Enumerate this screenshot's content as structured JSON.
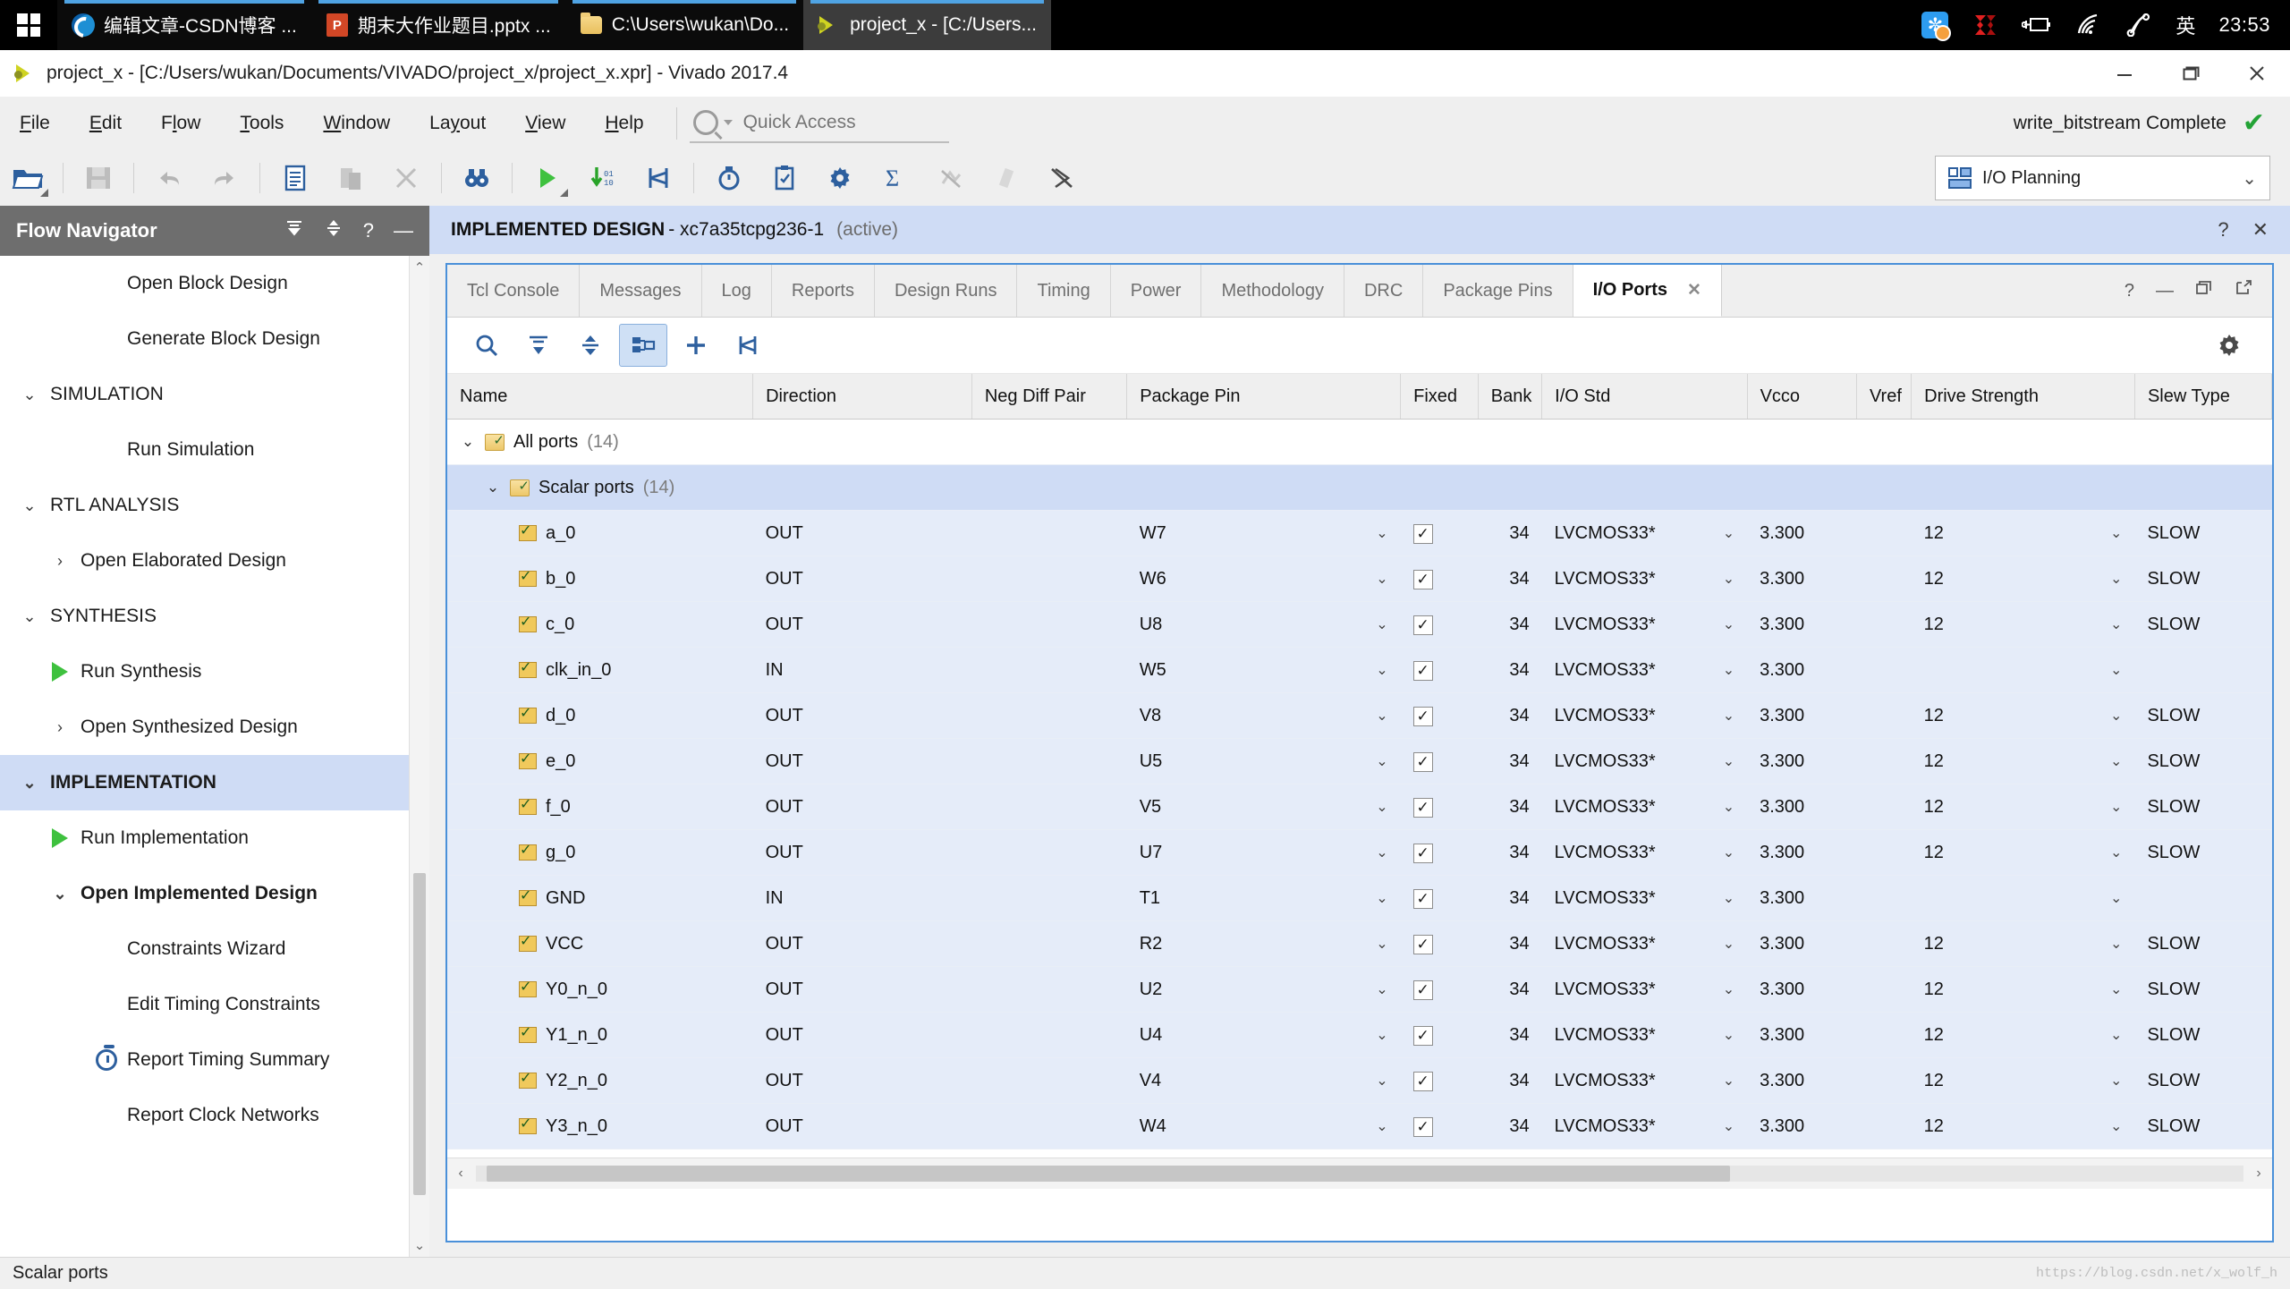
{
  "taskbar": {
    "start_icon": "windows-logo",
    "items": [
      {
        "icon": "edge-icon",
        "label": "编辑文章-CSDN博客 ...",
        "active": false
      },
      {
        "icon": "powerpoint-icon",
        "label": "期末大作业题目.pptx ...",
        "active": false
      },
      {
        "icon": "folder-icon",
        "label": "C:\\Users\\wukan\\Do...",
        "active": false
      },
      {
        "icon": "vivado-icon",
        "label": "project_x - [C:/Users...",
        "active": true
      }
    ],
    "tray": {
      "sogou_label": "✼",
      "xilinx_label": "Σ",
      "battery_icon": "plug-battery-icon",
      "wifi_icon": "wifi-icon",
      "sound_icon": "sound-icon",
      "ime_label": "英",
      "clock": "23:53"
    }
  },
  "titlebar": {
    "icon": "vivado-icon",
    "title": "project_x - [C:/Users/wukan/Documents/VIVADO/project_x/project_x.xpr] - Vivado 2017.4",
    "minimize": "minimize-button",
    "maximize": "maximize-button",
    "close": "close-button"
  },
  "menubar": {
    "items": [
      {
        "label": "File",
        "accel": "F"
      },
      {
        "label": "Edit",
        "accel": "E"
      },
      {
        "label": "Flow",
        "accel": "l"
      },
      {
        "label": "Tools",
        "accel": "T"
      },
      {
        "label": "Window",
        "accel": "W"
      },
      {
        "label": "Layout",
        "accel": "y"
      },
      {
        "label": "View",
        "accel": "V"
      },
      {
        "label": "Help",
        "accel": "H"
      }
    ],
    "quick_access_placeholder": "Quick Access",
    "quick_access_value": "",
    "status_text": "write_bitstream Complete",
    "status_check": "✔"
  },
  "toolbar": {
    "buttons": [
      {
        "name": "open-project-icon",
        "glyph": "open-folder"
      },
      {
        "name": "save-icon",
        "glyph": "floppy"
      },
      {
        "name": "undo-icon",
        "glyph": "undo"
      },
      {
        "name": "redo-icon",
        "glyph": "redo"
      },
      {
        "name": "copy-icon",
        "glyph": "document"
      },
      {
        "name": "paste-icon",
        "glyph": "paste"
      },
      {
        "name": "delete-icon",
        "glyph": "x"
      },
      {
        "name": "find-icon",
        "glyph": "binoculars"
      },
      {
        "name": "run-icon",
        "glyph": "play"
      },
      {
        "name": "write-bitstream-icon",
        "glyph": "down-bits"
      },
      {
        "name": "open-hw-manager-icon",
        "glyph": "hw"
      },
      {
        "name": "report-timing-icon",
        "glyph": "clock"
      },
      {
        "name": "report-drc-icon",
        "glyph": "clipboard"
      },
      {
        "name": "settings-icon",
        "glyph": "gear"
      },
      {
        "name": "report-utilization-icon",
        "glyph": "sigma"
      },
      {
        "name": "report-power-icon",
        "glyph": "power"
      },
      {
        "name": "report-noise-icon",
        "glyph": "noise"
      },
      {
        "name": "report-clock-icon",
        "glyph": "clock-x"
      }
    ],
    "layout_select": {
      "icon": "io-planning-icon",
      "value": "I/O Planning",
      "chevron": "⌄"
    }
  },
  "flow_navigator": {
    "title": "Flow Navigator",
    "header_icons": [
      "collapse-all-icon",
      "expand-all-icon",
      "help-icon",
      "minimize-icon"
    ],
    "items": [
      {
        "label": "Open Block Design",
        "indent": 2,
        "chevron": "",
        "icon": "",
        "selected": false,
        "bold": false
      },
      {
        "label": "Generate Block Design",
        "indent": 2,
        "chevron": "",
        "icon": "",
        "selected": false,
        "bold": false
      },
      {
        "label": "SIMULATION",
        "indent": 0,
        "chevron": "⌄",
        "icon": "",
        "selected": false,
        "bold": false
      },
      {
        "label": "Run Simulation",
        "indent": 2,
        "chevron": "",
        "icon": "",
        "selected": false,
        "bold": false
      },
      {
        "label": "RTL ANALYSIS",
        "indent": 0,
        "chevron": "⌄",
        "icon": "",
        "selected": false,
        "bold": false
      },
      {
        "label": "Open Elaborated Design",
        "indent": 1,
        "chevron": "›",
        "icon": "",
        "selected": false,
        "bold": false
      },
      {
        "label": "SYNTHESIS",
        "indent": 0,
        "chevron": "⌄",
        "icon": "",
        "selected": false,
        "bold": false
      },
      {
        "label": "Run Synthesis",
        "indent": 1,
        "chevron": "",
        "icon": "play",
        "selected": false,
        "bold": false
      },
      {
        "label": "Open Synthesized Design",
        "indent": 1,
        "chevron": "›",
        "icon": "",
        "selected": false,
        "bold": false
      },
      {
        "label": "IMPLEMENTATION",
        "indent": 0,
        "chevron": "⌄",
        "icon": "",
        "selected": true,
        "bold": true
      },
      {
        "label": "Run Implementation",
        "indent": 1,
        "chevron": "",
        "icon": "play",
        "selected": false,
        "bold": false
      },
      {
        "label": "Open Implemented Design",
        "indent": 1,
        "chevron": "⌄",
        "icon": "",
        "selected": false,
        "bold": true
      },
      {
        "label": "Constraints Wizard",
        "indent": 2,
        "chevron": "",
        "icon": "",
        "selected": false,
        "bold": false
      },
      {
        "label": "Edit Timing Constraints",
        "indent": 2,
        "chevron": "",
        "icon": "",
        "selected": false,
        "bold": false
      },
      {
        "label": "Report Timing Summary",
        "indent": 2,
        "chevron": "",
        "icon": "clock",
        "selected": false,
        "bold": false
      },
      {
        "label": "Report Clock Networks",
        "indent": 2,
        "chevron": "",
        "icon": "",
        "selected": false,
        "bold": false
      }
    ]
  },
  "design_bar": {
    "title": "IMPLEMENTED DESIGN",
    "part": "- xc7a35tcpg236-1",
    "state": "(active)",
    "icons": [
      "help-icon",
      "close-icon"
    ]
  },
  "panel": {
    "tabs": [
      {
        "label": "Tcl Console",
        "active": false,
        "closable": false
      },
      {
        "label": "Messages",
        "active": false,
        "closable": false
      },
      {
        "label": "Log",
        "active": false,
        "closable": false
      },
      {
        "label": "Reports",
        "active": false,
        "closable": false
      },
      {
        "label": "Design Runs",
        "active": false,
        "closable": false
      },
      {
        "label": "Timing",
        "active": false,
        "closable": false
      },
      {
        "label": "Power",
        "active": false,
        "closable": false
      },
      {
        "label": "Methodology",
        "active": false,
        "closable": false
      },
      {
        "label": "DRC",
        "active": false,
        "closable": false
      },
      {
        "label": "Package Pins",
        "active": false,
        "closable": false
      },
      {
        "label": "I/O Ports",
        "active": true,
        "closable": true,
        "close_glyph": "✕"
      }
    ],
    "tab_controls": [
      "help-icon",
      "minimize-icon",
      "restore-icon",
      "float-icon"
    ],
    "panel_toolbar": [
      {
        "name": "search-icon",
        "glyph": "search",
        "selected": false
      },
      {
        "name": "collapse-all-icon",
        "glyph": "collapse",
        "selected": false
      },
      {
        "name": "expand-all-icon",
        "glyph": "expand",
        "selected": false
      },
      {
        "name": "auto-fit-columns-icon",
        "glyph": "fit",
        "selected": true
      },
      {
        "name": "add-icon",
        "glyph": "plus",
        "selected": false
      },
      {
        "name": "group-icon",
        "glyph": "group",
        "selected": false
      }
    ],
    "settings_icon": "gear-icon"
  },
  "table": {
    "columns": [
      "Name",
      "Direction",
      "Neg Diff Pair",
      "Package Pin",
      "Fixed",
      "Bank",
      "I/O Std",
      "Vcco",
      "Vref",
      "Drive Strength",
      "Slew Type"
    ],
    "groups": [
      {
        "label": "All ports",
        "count": "(14)",
        "chevron": "⌄",
        "selected": false,
        "level": 0
      },
      {
        "label": "Scalar ports",
        "count": "(14)",
        "chevron": "⌄",
        "selected": true,
        "level": 1
      }
    ],
    "rows": [
      {
        "name": "a_0",
        "direction": "OUT",
        "neg_diff_pair": "",
        "package_pin": "W7",
        "fixed": "✓",
        "bank": "34",
        "io_std": "LVCMOS33*",
        "vcco": "3.300",
        "vref": "",
        "drive_strength": "12",
        "slew_type": "SLOW"
      },
      {
        "name": "b_0",
        "direction": "OUT",
        "neg_diff_pair": "",
        "package_pin": "W6",
        "fixed": "✓",
        "bank": "34",
        "io_std": "LVCMOS33*",
        "vcco": "3.300",
        "vref": "",
        "drive_strength": "12",
        "slew_type": "SLOW"
      },
      {
        "name": "c_0",
        "direction": "OUT",
        "neg_diff_pair": "",
        "package_pin": "U8",
        "fixed": "✓",
        "bank": "34",
        "io_std": "LVCMOS33*",
        "vcco": "3.300",
        "vref": "",
        "drive_strength": "12",
        "slew_type": "SLOW"
      },
      {
        "name": "clk_in_0",
        "direction": "IN",
        "neg_diff_pair": "",
        "package_pin": "W5",
        "fixed": "✓",
        "bank": "34",
        "io_std": "LVCMOS33*",
        "vcco": "3.300",
        "vref": "",
        "drive_strength": "",
        "slew_type": ""
      },
      {
        "name": "d_0",
        "direction": "OUT",
        "neg_diff_pair": "",
        "package_pin": "V8",
        "fixed": "✓",
        "bank": "34",
        "io_std": "LVCMOS33*",
        "vcco": "3.300",
        "vref": "",
        "drive_strength": "12",
        "slew_type": "SLOW"
      },
      {
        "name": "e_0",
        "direction": "OUT",
        "neg_diff_pair": "",
        "package_pin": "U5",
        "fixed": "✓",
        "bank": "34",
        "io_std": "LVCMOS33*",
        "vcco": "3.300",
        "vref": "",
        "drive_strength": "12",
        "slew_type": "SLOW"
      },
      {
        "name": "f_0",
        "direction": "OUT",
        "neg_diff_pair": "",
        "package_pin": "V5",
        "fixed": "✓",
        "bank": "34",
        "io_std": "LVCMOS33*",
        "vcco": "3.300",
        "vref": "",
        "drive_strength": "12",
        "slew_type": "SLOW"
      },
      {
        "name": "g_0",
        "direction": "OUT",
        "neg_diff_pair": "",
        "package_pin": "U7",
        "fixed": "✓",
        "bank": "34",
        "io_std": "LVCMOS33*",
        "vcco": "3.300",
        "vref": "",
        "drive_strength": "12",
        "slew_type": "SLOW"
      },
      {
        "name": "GND",
        "direction": "IN",
        "neg_diff_pair": "",
        "package_pin": "T1",
        "fixed": "✓",
        "bank": "34",
        "io_std": "LVCMOS33*",
        "vcco": "3.300",
        "vref": "",
        "drive_strength": "",
        "slew_type": ""
      },
      {
        "name": "VCC",
        "direction": "OUT",
        "neg_diff_pair": "",
        "package_pin": "R2",
        "fixed": "✓",
        "bank": "34",
        "io_std": "LVCMOS33*",
        "vcco": "3.300",
        "vref": "",
        "drive_strength": "12",
        "slew_type": "SLOW"
      },
      {
        "name": "Y0_n_0",
        "direction": "OUT",
        "neg_diff_pair": "",
        "package_pin": "U2",
        "fixed": "✓",
        "bank": "34",
        "io_std": "LVCMOS33*",
        "vcco": "3.300",
        "vref": "",
        "drive_strength": "12",
        "slew_type": "SLOW"
      },
      {
        "name": "Y1_n_0",
        "direction": "OUT",
        "neg_diff_pair": "",
        "package_pin": "U4",
        "fixed": "✓",
        "bank": "34",
        "io_std": "LVCMOS33*",
        "vcco": "3.300",
        "vref": "",
        "drive_strength": "12",
        "slew_type": "SLOW"
      },
      {
        "name": "Y2_n_0",
        "direction": "OUT",
        "neg_diff_pair": "",
        "package_pin": "V4",
        "fixed": "✓",
        "bank": "34",
        "io_std": "LVCMOS33*",
        "vcco": "3.300",
        "vref": "",
        "drive_strength": "12",
        "slew_type": "SLOW"
      },
      {
        "name": "Y3_n_0",
        "direction": "OUT",
        "neg_diff_pair": "",
        "package_pin": "W4",
        "fixed": "✓",
        "bank": "34",
        "io_std": "LVCMOS33*",
        "vcco": "3.300",
        "vref": "",
        "drive_strength": "12",
        "slew_type": "SLOW"
      }
    ]
  },
  "statusbar": {
    "text": "Scalar ports",
    "watermark": "https://blog.csdn.net/x_wolf_h"
  }
}
